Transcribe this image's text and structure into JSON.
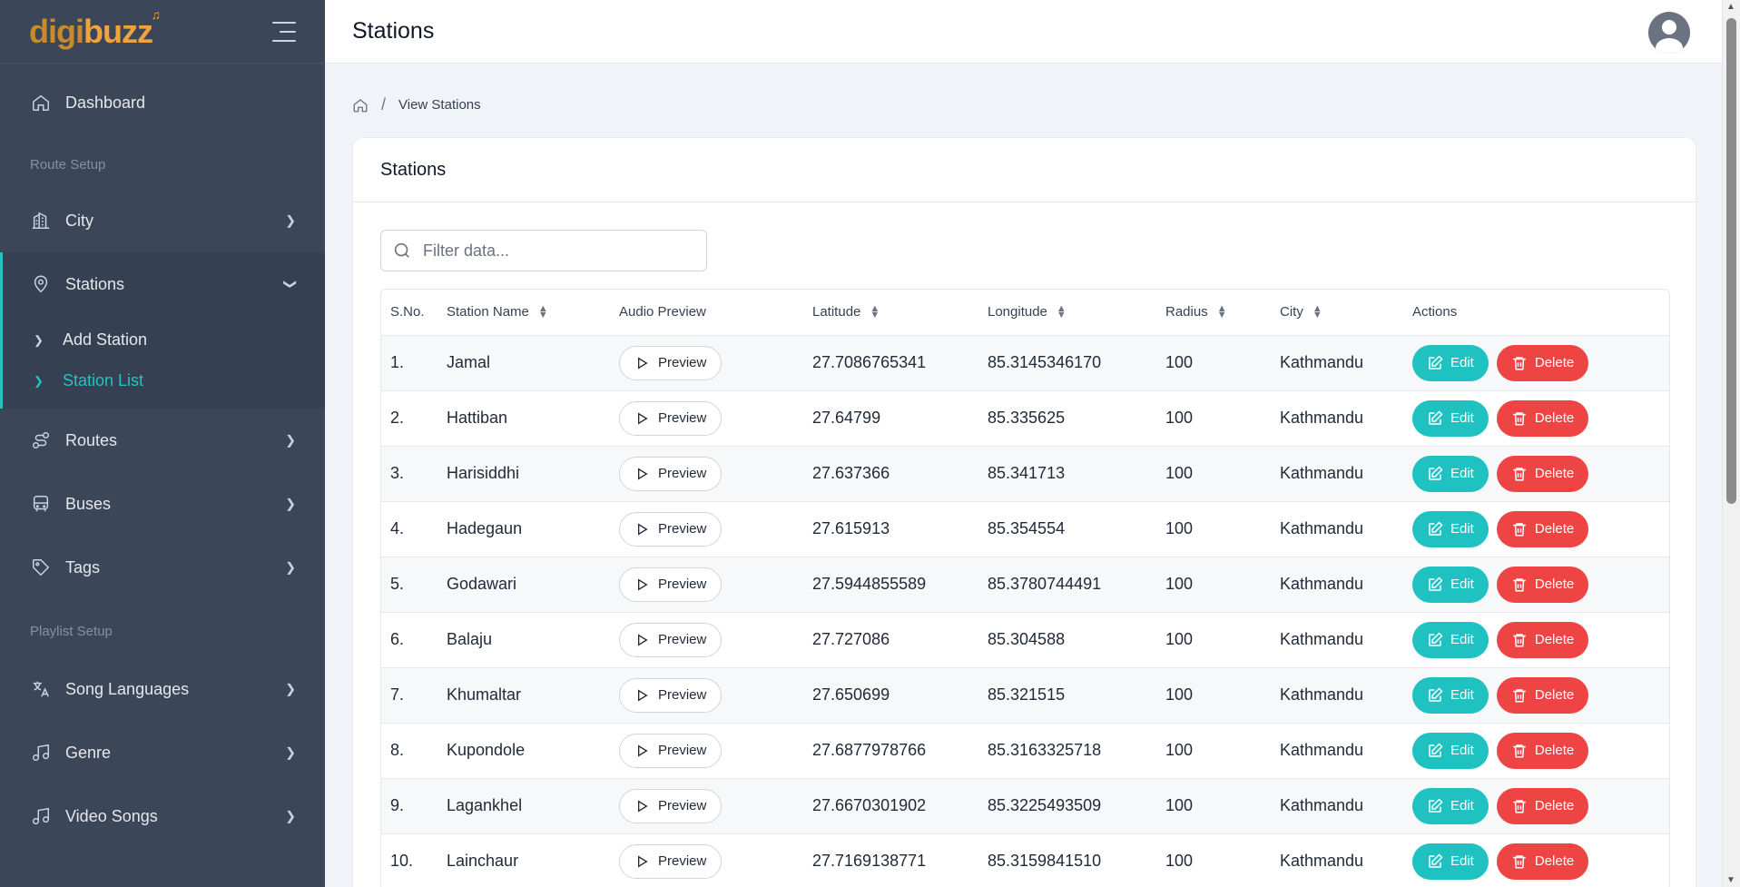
{
  "brand": {
    "logo_part1": "digi",
    "logo_part2": "buzz",
    "logo_sup": "♫"
  },
  "header": {
    "title": "Stations"
  },
  "sidebar": {
    "dashboard": "Dashboard",
    "section_route": "Route Setup",
    "city": "City",
    "stations": "Stations",
    "add_station": "Add Station",
    "station_list": "Station List",
    "routes": "Routes",
    "buses": "Buses",
    "tags": "Tags",
    "section_playlist": "Playlist Setup",
    "song_languages": "Song Languages",
    "genre": "Genre",
    "video_songs": "Video Songs"
  },
  "breadcrumb": {
    "current": "View Stations"
  },
  "card": {
    "title": "Stations"
  },
  "search": {
    "placeholder": "Filter data..."
  },
  "table": {
    "headers": {
      "sno": "S.No.",
      "station_name": "Station Name",
      "audio_preview": "Audio Preview",
      "latitude": "Latitude",
      "longitude": "Longitude",
      "radius": "Radius",
      "city": "City",
      "actions": "Actions"
    },
    "preview_label": "Preview",
    "edit_label": "Edit",
    "delete_label": "Delete",
    "rows": [
      {
        "sno": "1.",
        "name": "Jamal",
        "lat": "27.7086765341",
        "lng": "85.3145346170",
        "radius": "100",
        "city": "Kathmandu"
      },
      {
        "sno": "2.",
        "name": "Hattiban",
        "lat": "27.64799",
        "lng": "85.335625",
        "radius": "100",
        "city": "Kathmandu"
      },
      {
        "sno": "3.",
        "name": "Harisiddhi",
        "lat": "27.637366",
        "lng": "85.341713",
        "radius": "100",
        "city": "Kathmandu"
      },
      {
        "sno": "4.",
        "name": "Hadegaun",
        "lat": "27.615913",
        "lng": "85.354554",
        "radius": "100",
        "city": "Kathmandu"
      },
      {
        "sno": "5.",
        "name": "Godawari",
        "lat": "27.5944855589",
        "lng": "85.3780744491",
        "radius": "100",
        "city": "Kathmandu"
      },
      {
        "sno": "6.",
        "name": "Balaju",
        "lat": "27.727086",
        "lng": "85.304588",
        "radius": "100",
        "city": "Kathmandu"
      },
      {
        "sno": "7.",
        "name": "Khumaltar",
        "lat": "27.650699",
        "lng": "85.321515",
        "radius": "100",
        "city": "Kathmandu"
      },
      {
        "sno": "8.",
        "name": "Kupondole",
        "lat": "27.6877978766",
        "lng": "85.3163325718",
        "radius": "100",
        "city": "Kathmandu"
      },
      {
        "sno": "9.",
        "name": "Lagankhel",
        "lat": "27.6670301902",
        "lng": "85.3225493509",
        "radius": "100",
        "city": "Kathmandu"
      },
      {
        "sno": "10.",
        "name": "Lainchaur",
        "lat": "27.7169138771",
        "lng": "85.3159841510",
        "radius": "100",
        "city": "Kathmandu"
      }
    ]
  },
  "colors": {
    "accent": "#1fc1c1",
    "danger": "#ef4444",
    "sidebar_bg": "#3b4659",
    "brand": "#f2a23a"
  }
}
